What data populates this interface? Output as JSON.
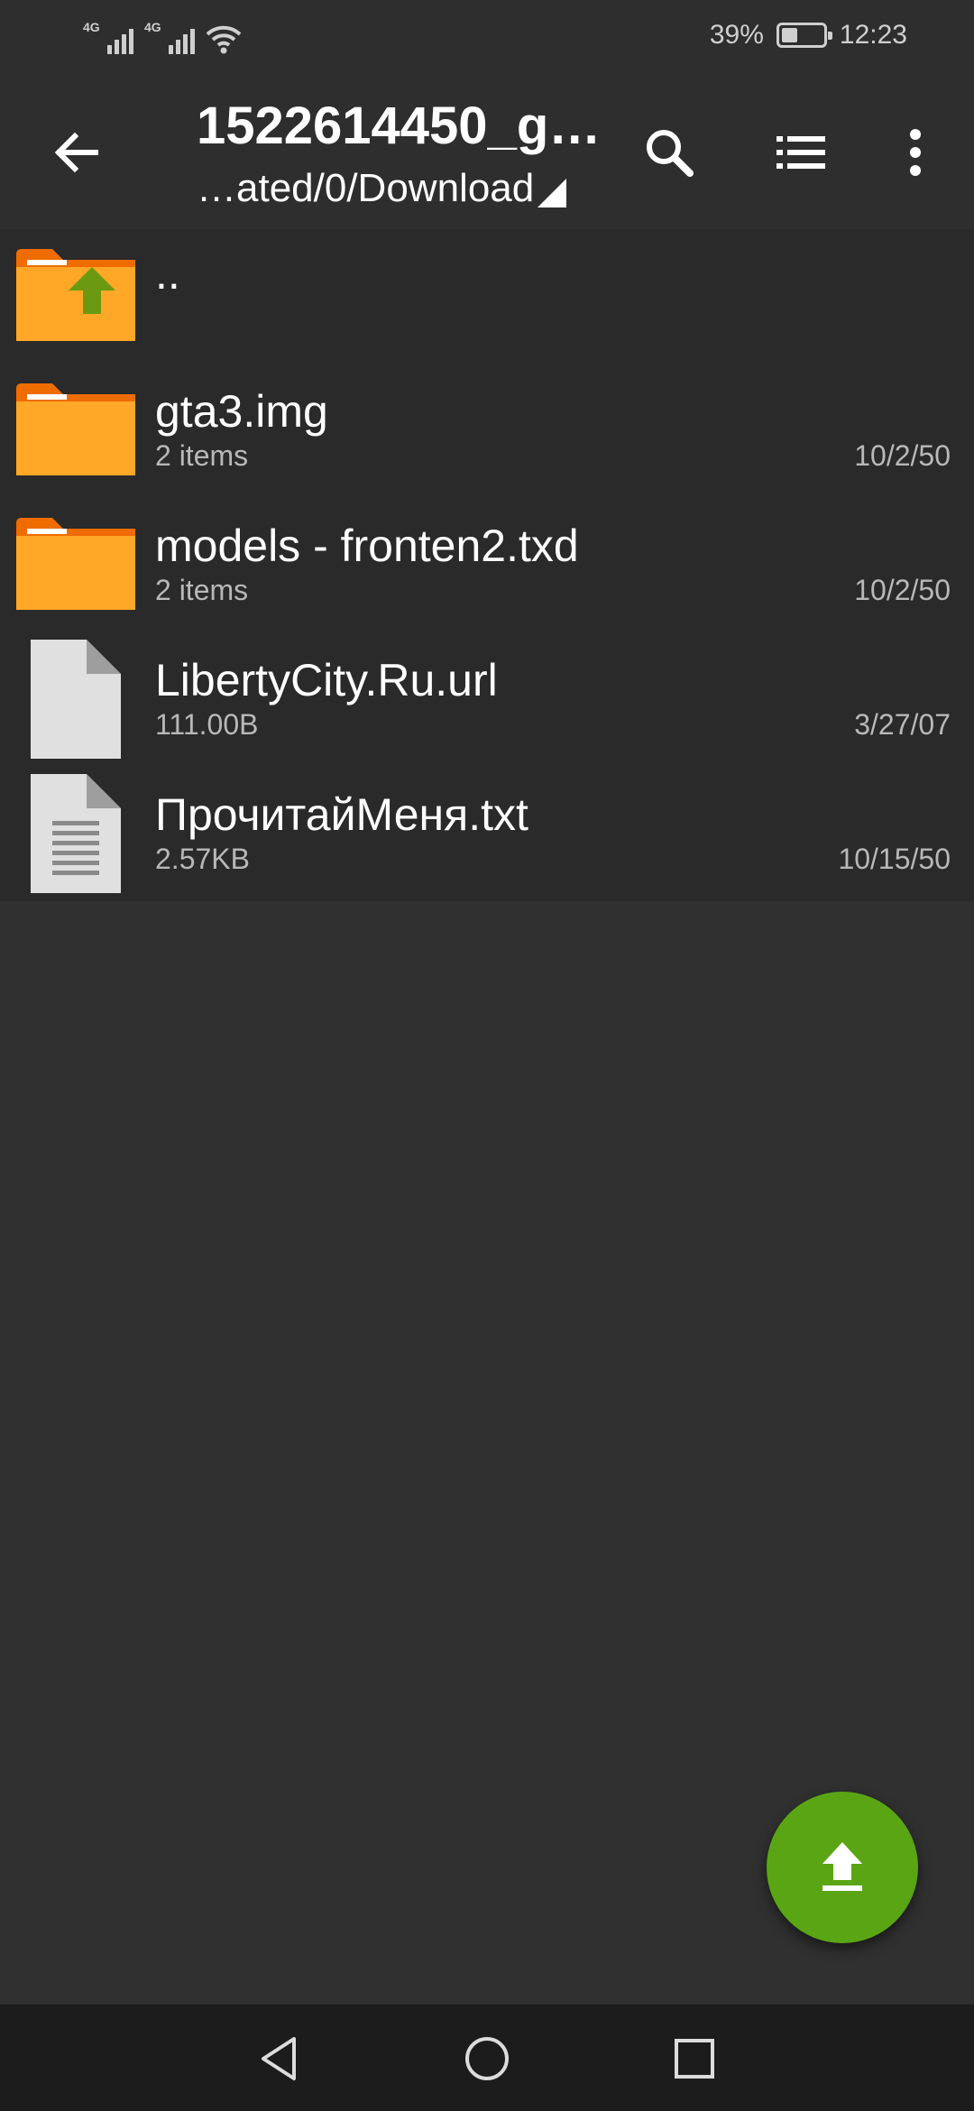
{
  "status_bar": {
    "network_1": "4G",
    "network_2": "4G",
    "battery_percent": "39%",
    "battery_level": 0.39,
    "time": "12:23"
  },
  "toolbar": {
    "title": "1522614450_g…",
    "path": "…ated/0/Download",
    "icons": [
      "back-arrow-icon",
      "search-icon",
      "list-view-icon",
      "more-vert-icon"
    ]
  },
  "files": [
    {
      "name": "..",
      "meta": "",
      "date": "",
      "icon": "parent-folder-icon"
    },
    {
      "name": "gta3.img",
      "meta": "2 items",
      "date": "10/2/50",
      "icon": "folder-icon"
    },
    {
      "name": "models - fronten2.txd",
      "meta": "2 items",
      "date": "10/2/50",
      "icon": "folder-icon"
    },
    {
      "name": "LibertyCity.Ru.url",
      "meta": "111.00B",
      "date": "3/27/07",
      "icon": "file-icon"
    },
    {
      "name": "ПрочитайМеня.txt",
      "meta": "2.57KB",
      "date": "10/15/50",
      "icon": "text-file-icon"
    }
  ],
  "fab": {
    "icon": "upload-icon"
  },
  "colors": {
    "background": "#303030",
    "toolbar": "#2e2e2e",
    "folder": "#ffa726",
    "folder_tab": "#ef6c00",
    "up_arrow": "#6b9a12",
    "fab": "#5aa514"
  }
}
